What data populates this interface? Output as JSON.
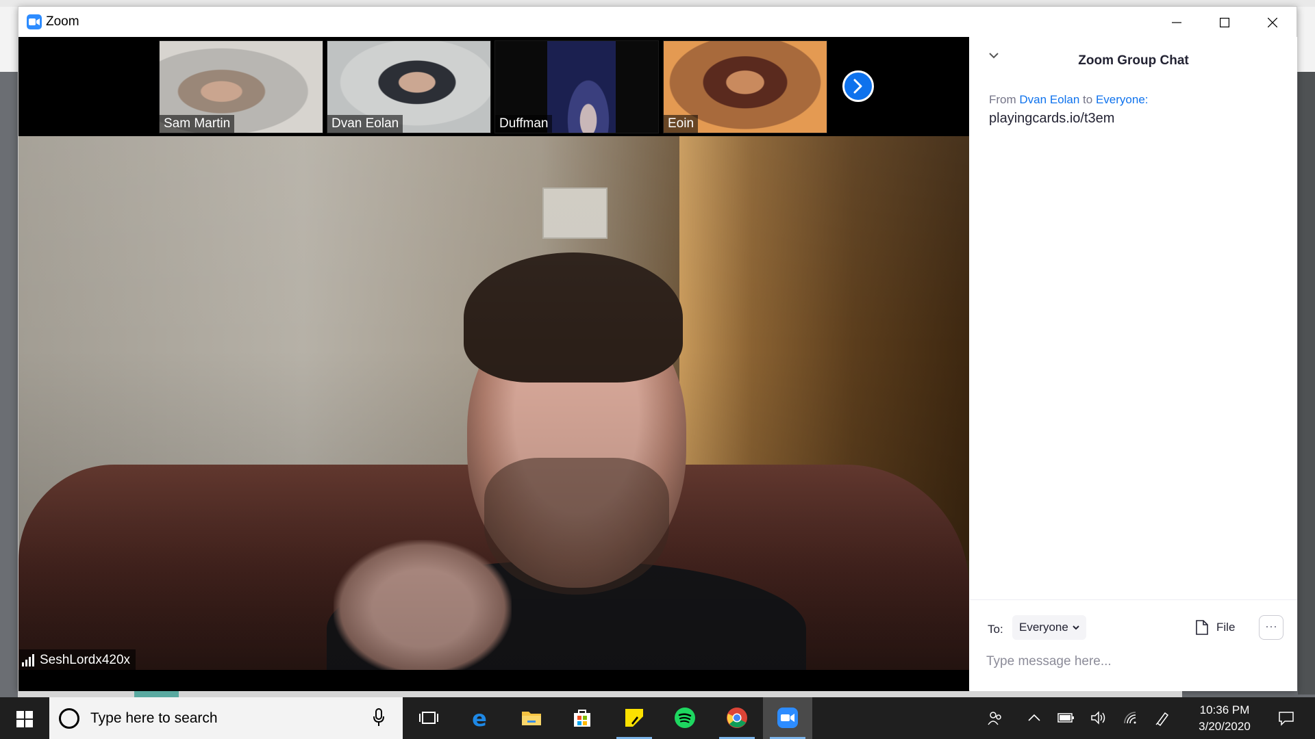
{
  "window": {
    "app_title": "Zoom",
    "controls": [
      "minimize-icon",
      "maximize-icon",
      "close-icon"
    ]
  },
  "gallery": {
    "participants": [
      {
        "name": "Sam Martin"
      },
      {
        "name": "Dvan Eolan"
      },
      {
        "name": "Duffman"
      },
      {
        "name": "Eoin"
      }
    ],
    "next_icon": "chevron-right-icon"
  },
  "active_speaker": {
    "name": "SeshLordx420x"
  },
  "chat": {
    "title": "Zoom Group Chat",
    "messages": [
      {
        "from_prefix": "From",
        "sender": "Dvan Eolan",
        "to_word": "to",
        "recipient": "Everyone:",
        "text": "playingcards.io/t3em"
      }
    ],
    "to_label": "To:",
    "to_value": "Everyone",
    "file_label": "File",
    "more_label": "···",
    "input_placeholder": "Type message here..."
  },
  "taskbar": {
    "search_placeholder": "Type here to search",
    "pinned_apps": [
      "windows-start-icon",
      "task-view-icon",
      "edge-icon",
      "file-explorer-icon",
      "store-icon",
      "sticky-notes-icon",
      "spotify-icon",
      "chrome-icon",
      "zoom-icon"
    ],
    "clock_time": "10:36 PM",
    "clock_date": "3/20/2020"
  },
  "colors": {
    "zoom_blue": "#0e72ed",
    "taskbar_bg": "#1f1f1f",
    "chat_link": "#0e72ed"
  }
}
